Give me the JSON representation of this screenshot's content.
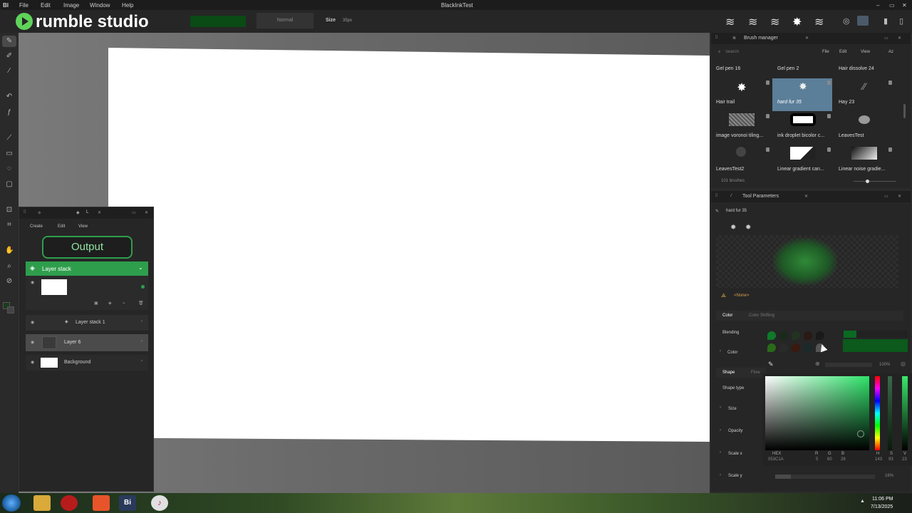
{
  "menubar": {
    "logo": "BI",
    "items": [
      "File",
      "Edit",
      "Image",
      "Window",
      "Help"
    ],
    "title": "BlackInkTest"
  },
  "brand": {
    "logo_text": "rumble studio"
  },
  "toolbar": {
    "color_hex": "#0a4a14",
    "blend_mode": "Normal",
    "size_label": "Size",
    "size_value": "35px"
  },
  "layers_panel": {
    "tab_label": "L",
    "menu": [
      "Create",
      "Edit",
      "View"
    ],
    "output_label": "Output",
    "layer_stack_header": "Layer stack",
    "layers": [
      {
        "name": "Layer stack 1"
      },
      {
        "name": "Layer 6"
      },
      {
        "name": "Background"
      }
    ]
  },
  "brush_manager": {
    "title": "Brush manager",
    "search_placeholder": "Search",
    "menu": [
      "File",
      "Edit",
      "View"
    ],
    "sort_label": "Az",
    "brushes": [
      {
        "name": "Gel pen 16"
      },
      {
        "name": "Gel pen 2"
      },
      {
        "name": "Hair dissolve 24"
      },
      {
        "name": "Hair trail"
      },
      {
        "name": "hard fur 35"
      },
      {
        "name": "Hay 23"
      },
      {
        "name": "image voronoi tiling..."
      },
      {
        "name": "ink droplet bicolor c..."
      },
      {
        "name": "LeavesTest"
      },
      {
        "name": "LeavesTest2"
      },
      {
        "name": "Linear gradient can..."
      },
      {
        "name": "Linear noise gradie..."
      }
    ],
    "count_label": "101 brushes"
  },
  "tool_params": {
    "title": "Tool Parameters",
    "brush_name": "hard fur 35",
    "none_label": "<None>",
    "tabs": [
      "Color",
      "Color Shifting"
    ],
    "blending_label": "Blending",
    "color_label": "Color",
    "opacity_pct": "100%",
    "shape_tabs": [
      "Shape",
      "Flow"
    ],
    "rows": [
      "Shape type",
      "Size",
      "Opacity",
      "Scale x",
      "Scale y"
    ],
    "scale_y_pct": "16%"
  },
  "color_picker": {
    "hex_label": "HEX",
    "hex_value": "053C1A",
    "r_label": "R",
    "r_value": "5",
    "g_label": "G",
    "g_value": "60",
    "b_label": "B",
    "b_value": "26",
    "h_label": "H",
    "h_value": "143",
    "s_label": "S",
    "s_value": "93",
    "v_label": "V",
    "v_value": "23"
  },
  "taskbar": {
    "time": "11:06 PM",
    "date": "7/13/2025",
    "app_badge": "Bi"
  },
  "colors": {
    "accent_green": "#2e9e4c",
    "selected_blue": "#5b7e99"
  }
}
